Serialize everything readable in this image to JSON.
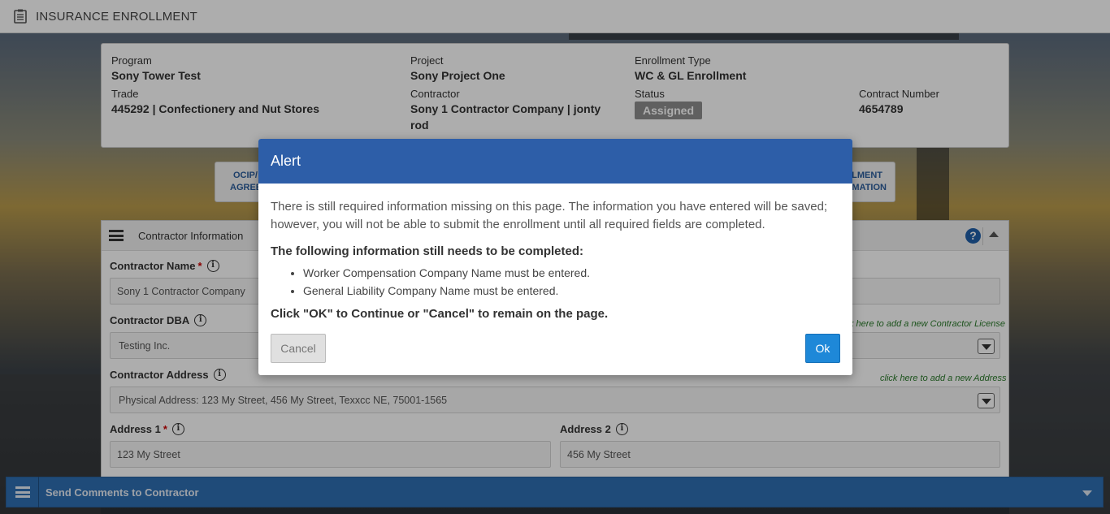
{
  "header": {
    "title": "INSURANCE ENROLLMENT",
    "icon": "clipboard-icon"
  },
  "info": {
    "program_label": "Program",
    "program": "Sony Tower Test",
    "project_label": "Project",
    "project": "Sony Project One",
    "enrollment_type_label": "Enrollment Type",
    "enrollment_type": "WC & GL Enrollment",
    "trade_label": "Trade",
    "trade": "445292 | Confectionery and Nut Stores",
    "contractor_label": "Contractor",
    "contractor": "Sony 1 Contractor Company | jonty rod",
    "status_label": "Status",
    "status": "Assigned",
    "contract_number_label": "Contract Number",
    "contract_number": "4654789"
  },
  "steps": {
    "left_line1": "OCIP/",
    "left_line2": "AGREE",
    "right_line1": "LLMENT",
    "right_line2": "MATION"
  },
  "contractor_panel": {
    "title": "Contractor Information",
    "name_label": "Contractor Name",
    "name_value": "Sony 1 Contractor Company",
    "dba_label": "Contractor DBA",
    "dba_value": "Testing Inc.",
    "license_link": "k here to add a new Contractor License",
    "address_label": "Contractor Address",
    "address_link": "click here to add a new Address",
    "address_value": "Physical Address: 123 My Street, 456 My Street, Texxcc NE, 75001-1565",
    "address1_label": "Address 1",
    "address1_value": "123 My Street",
    "address2_label": "Address 2",
    "address2_value": "456 My Street"
  },
  "bottombar": {
    "label": "Send Comments to Contractor"
  },
  "modal": {
    "title": "Alert",
    "message": "There is still required information missing on this page. The information you have entered will be saved; however, you will not be able to submit the enrollment until all required fields are completed.",
    "subheading": "The following information still needs to be completed:",
    "items": [
      "Worker Compensation Company Name must be entered.",
      "General Liability Company Name must be entered."
    ],
    "confirm": "Click \"OK\" to Continue or \"Cancel\" to remain on the page.",
    "cancel_label": "Cancel",
    "ok_label": "Ok"
  },
  "colors": {
    "modal_header": "#2d5ea8",
    "ok_button": "#1e88d8",
    "bottombar": "#2f6fb3",
    "status_badge": "#8e8e8e"
  }
}
